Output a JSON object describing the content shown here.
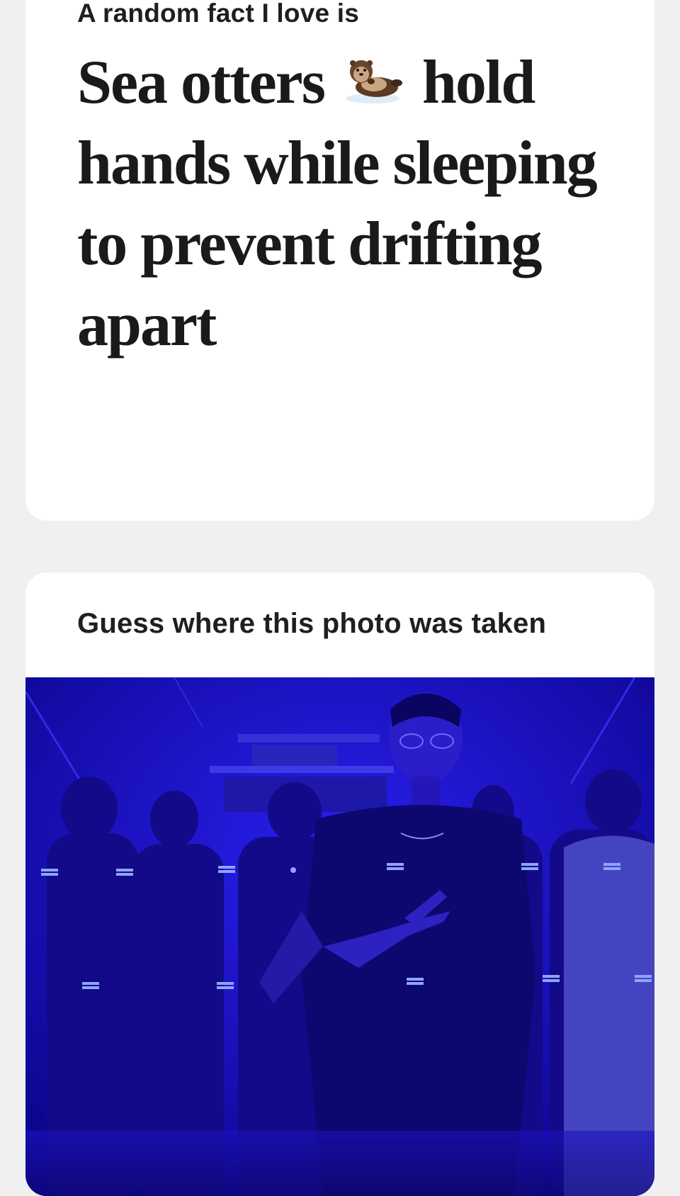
{
  "prompt_card": {
    "label": "A random fact I love is",
    "answer_before": "Sea otters",
    "answer_emoji_icon": "sea-otter-icon",
    "answer_after": "hold hands while sleeping to prevent drifting apart"
  },
  "photo_card": {
    "label": "Guess where this photo was taken",
    "photo_icon": "concert-photo",
    "photo_tint": "#1a10c8"
  },
  "colors": {
    "background": "#f0f0f0",
    "card": "#ffffff",
    "text": "#1f1f1f"
  }
}
